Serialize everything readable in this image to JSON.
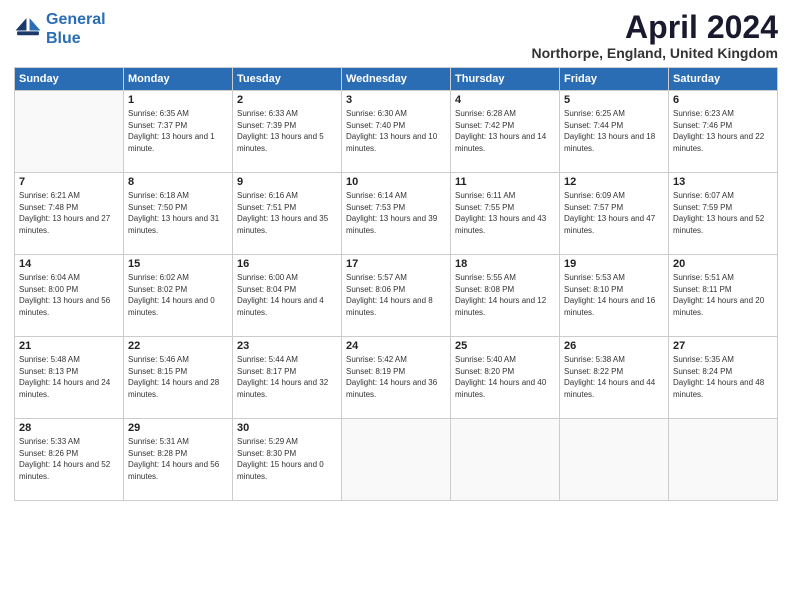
{
  "logo": {
    "line1": "General",
    "line2": "Blue"
  },
  "title": "April 2024",
  "location": "Northorpe, England, United Kingdom",
  "days_header": [
    "Sunday",
    "Monday",
    "Tuesday",
    "Wednesday",
    "Thursday",
    "Friday",
    "Saturday"
  ],
  "weeks": [
    [
      {
        "day": "",
        "sunrise": "",
        "sunset": "",
        "daylight": ""
      },
      {
        "day": "1",
        "sunrise": "Sunrise: 6:35 AM",
        "sunset": "Sunset: 7:37 PM",
        "daylight": "Daylight: 13 hours and 1 minute."
      },
      {
        "day": "2",
        "sunrise": "Sunrise: 6:33 AM",
        "sunset": "Sunset: 7:39 PM",
        "daylight": "Daylight: 13 hours and 5 minutes."
      },
      {
        "day": "3",
        "sunrise": "Sunrise: 6:30 AM",
        "sunset": "Sunset: 7:40 PM",
        "daylight": "Daylight: 13 hours and 10 minutes."
      },
      {
        "day": "4",
        "sunrise": "Sunrise: 6:28 AM",
        "sunset": "Sunset: 7:42 PM",
        "daylight": "Daylight: 13 hours and 14 minutes."
      },
      {
        "day": "5",
        "sunrise": "Sunrise: 6:25 AM",
        "sunset": "Sunset: 7:44 PM",
        "daylight": "Daylight: 13 hours and 18 minutes."
      },
      {
        "day": "6",
        "sunrise": "Sunrise: 6:23 AM",
        "sunset": "Sunset: 7:46 PM",
        "daylight": "Daylight: 13 hours and 22 minutes."
      }
    ],
    [
      {
        "day": "7",
        "sunrise": "Sunrise: 6:21 AM",
        "sunset": "Sunset: 7:48 PM",
        "daylight": "Daylight: 13 hours and 27 minutes."
      },
      {
        "day": "8",
        "sunrise": "Sunrise: 6:18 AM",
        "sunset": "Sunset: 7:50 PM",
        "daylight": "Daylight: 13 hours and 31 minutes."
      },
      {
        "day": "9",
        "sunrise": "Sunrise: 6:16 AM",
        "sunset": "Sunset: 7:51 PM",
        "daylight": "Daylight: 13 hours and 35 minutes."
      },
      {
        "day": "10",
        "sunrise": "Sunrise: 6:14 AM",
        "sunset": "Sunset: 7:53 PM",
        "daylight": "Daylight: 13 hours and 39 minutes."
      },
      {
        "day": "11",
        "sunrise": "Sunrise: 6:11 AM",
        "sunset": "Sunset: 7:55 PM",
        "daylight": "Daylight: 13 hours and 43 minutes."
      },
      {
        "day": "12",
        "sunrise": "Sunrise: 6:09 AM",
        "sunset": "Sunset: 7:57 PM",
        "daylight": "Daylight: 13 hours and 47 minutes."
      },
      {
        "day": "13",
        "sunrise": "Sunrise: 6:07 AM",
        "sunset": "Sunset: 7:59 PM",
        "daylight": "Daylight: 13 hours and 52 minutes."
      }
    ],
    [
      {
        "day": "14",
        "sunrise": "Sunrise: 6:04 AM",
        "sunset": "Sunset: 8:00 PM",
        "daylight": "Daylight: 13 hours and 56 minutes."
      },
      {
        "day": "15",
        "sunrise": "Sunrise: 6:02 AM",
        "sunset": "Sunset: 8:02 PM",
        "daylight": "Daylight: 14 hours and 0 minutes."
      },
      {
        "day": "16",
        "sunrise": "Sunrise: 6:00 AM",
        "sunset": "Sunset: 8:04 PM",
        "daylight": "Daylight: 14 hours and 4 minutes."
      },
      {
        "day": "17",
        "sunrise": "Sunrise: 5:57 AM",
        "sunset": "Sunset: 8:06 PM",
        "daylight": "Daylight: 14 hours and 8 minutes."
      },
      {
        "day": "18",
        "sunrise": "Sunrise: 5:55 AM",
        "sunset": "Sunset: 8:08 PM",
        "daylight": "Daylight: 14 hours and 12 minutes."
      },
      {
        "day": "19",
        "sunrise": "Sunrise: 5:53 AM",
        "sunset": "Sunset: 8:10 PM",
        "daylight": "Daylight: 14 hours and 16 minutes."
      },
      {
        "day": "20",
        "sunrise": "Sunrise: 5:51 AM",
        "sunset": "Sunset: 8:11 PM",
        "daylight": "Daylight: 14 hours and 20 minutes."
      }
    ],
    [
      {
        "day": "21",
        "sunrise": "Sunrise: 5:48 AM",
        "sunset": "Sunset: 8:13 PM",
        "daylight": "Daylight: 14 hours and 24 minutes."
      },
      {
        "day": "22",
        "sunrise": "Sunrise: 5:46 AM",
        "sunset": "Sunset: 8:15 PM",
        "daylight": "Daylight: 14 hours and 28 minutes."
      },
      {
        "day": "23",
        "sunrise": "Sunrise: 5:44 AM",
        "sunset": "Sunset: 8:17 PM",
        "daylight": "Daylight: 14 hours and 32 minutes."
      },
      {
        "day": "24",
        "sunrise": "Sunrise: 5:42 AM",
        "sunset": "Sunset: 8:19 PM",
        "daylight": "Daylight: 14 hours and 36 minutes."
      },
      {
        "day": "25",
        "sunrise": "Sunrise: 5:40 AM",
        "sunset": "Sunset: 8:20 PM",
        "daylight": "Daylight: 14 hours and 40 minutes."
      },
      {
        "day": "26",
        "sunrise": "Sunrise: 5:38 AM",
        "sunset": "Sunset: 8:22 PM",
        "daylight": "Daylight: 14 hours and 44 minutes."
      },
      {
        "day": "27",
        "sunrise": "Sunrise: 5:35 AM",
        "sunset": "Sunset: 8:24 PM",
        "daylight": "Daylight: 14 hours and 48 minutes."
      }
    ],
    [
      {
        "day": "28",
        "sunrise": "Sunrise: 5:33 AM",
        "sunset": "Sunset: 8:26 PM",
        "daylight": "Daylight: 14 hours and 52 minutes."
      },
      {
        "day": "29",
        "sunrise": "Sunrise: 5:31 AM",
        "sunset": "Sunset: 8:28 PM",
        "daylight": "Daylight: 14 hours and 56 minutes."
      },
      {
        "day": "30",
        "sunrise": "Sunrise: 5:29 AM",
        "sunset": "Sunset: 8:30 PM",
        "daylight": "Daylight: 15 hours and 0 minutes."
      },
      {
        "day": "",
        "sunrise": "",
        "sunset": "",
        "daylight": ""
      },
      {
        "day": "",
        "sunrise": "",
        "sunset": "",
        "daylight": ""
      },
      {
        "day": "",
        "sunrise": "",
        "sunset": "",
        "daylight": ""
      },
      {
        "day": "",
        "sunrise": "",
        "sunset": "",
        "daylight": ""
      }
    ]
  ]
}
